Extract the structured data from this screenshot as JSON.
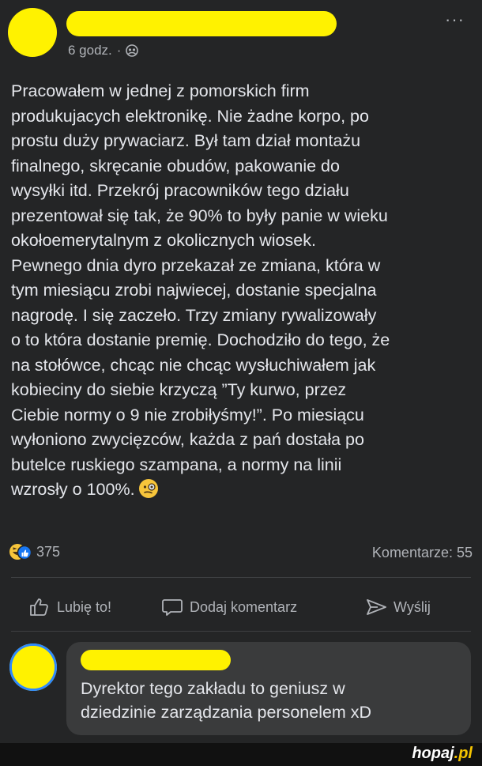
{
  "post": {
    "time": "6 godz.",
    "separator": "·",
    "more_label": "···",
    "text": "Pracowałem w jednej z pomorskich firm\nprodukujacych elektronikę. Nie żadne korpo, po\nprostu duży prywaciarz. Był tam dział montażu\nfinalnego, skręcanie obudów, pakowanie do\nwysyłki itd. Przekrój pracowników tego działu\nprezentował się tak, że 90% to były panie w wieku\nokołoemerytalnym z okolicznych wiosek.\nPewnego dnia dyro przekazał ze zmiana, która w\ntym miesiącu zrobi najwiecej, dostanie specjalna\nnagrodę. I się zaczeło. Trzy zmiany rywalizowały\no to która dostanie premię. Dochodziło do tego, że\nna stołówce, chcąc nie chcąc wysłuchiwałem jak\nkobieciny do siebie krzyczą ”Ty kurwo, przez\nCiebie normy o 9 nie zrobiłyśmy!”. Po miesiącu\nwyłoniono zwycięzców, każda z pań dostała po\nbutelce ruskiego szampana, a normy na linii\nwzrosły o 100%.",
    "reaction_count": "375",
    "comments_count": "Komentarze: 55"
  },
  "actions": {
    "like": "Lubię to!",
    "comment": "Dodaj komentarz",
    "share": "Wyślij"
  },
  "comment": {
    "text": "Dyrektor tego zakładu to geniusz w\ndziedzinie zarządzania personelem xD"
  },
  "watermark": {
    "name": "hopaj",
    "tld": ".pl"
  },
  "colors": {
    "background": "#242526",
    "redaction": "#fff200",
    "like_blue": "#1877f2"
  }
}
